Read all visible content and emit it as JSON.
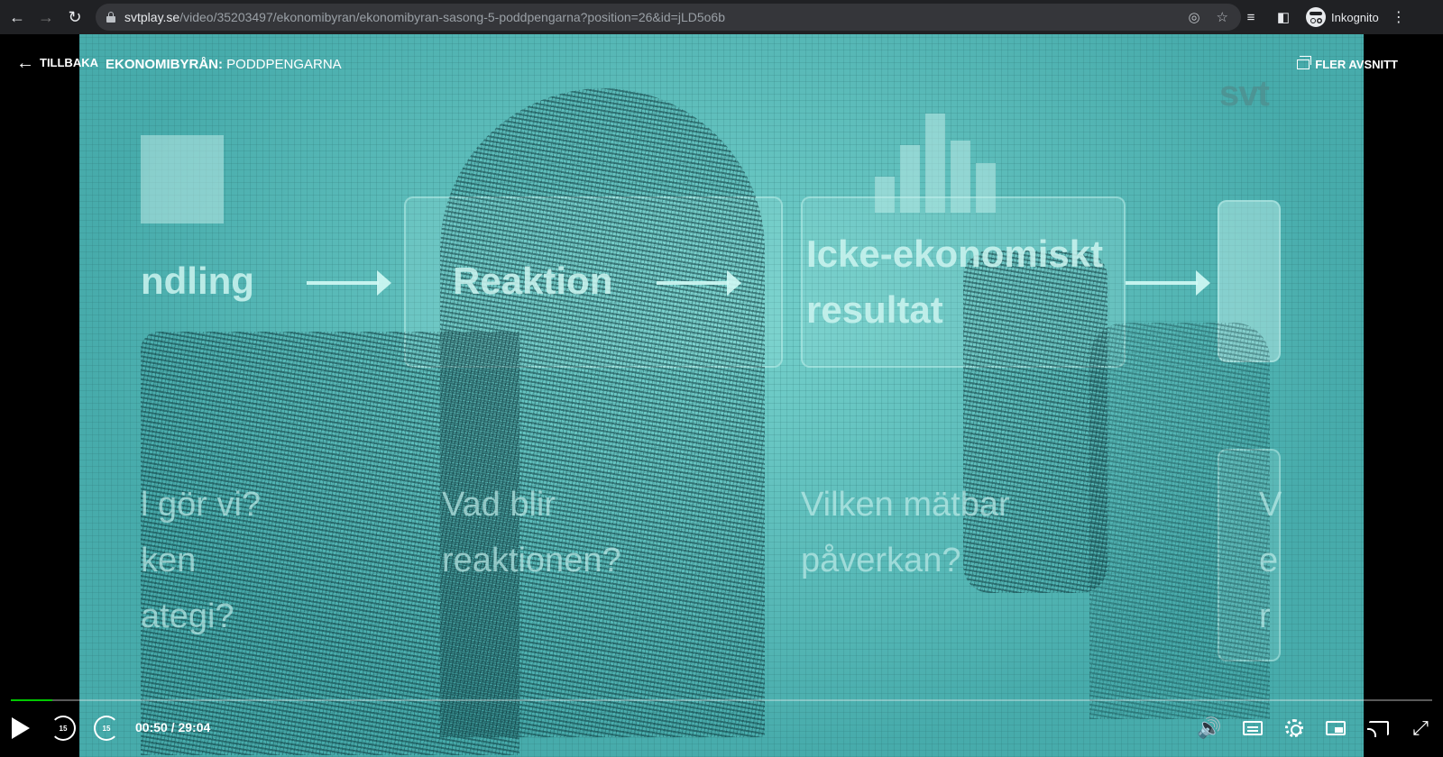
{
  "browser": {
    "url_host": "svtplay.se",
    "url_path": "/video/35203497/ekonomibyran/ekonomibyran-sasong-5-poddpengarna?position=26&id=jLD5o6b",
    "profile_label": "Inkognito"
  },
  "player": {
    "back_label": "TILLBAKA",
    "title_bold": "EKONOMIBYRÅN:",
    "title_rest": " PODDPENGARNA",
    "more_label": "FLER AVSNITT",
    "current_time": "00:50",
    "duration": "29:04",
    "time_display": "00:50 / 29:04",
    "progress_fraction": 0.029,
    "skip_back_label": "15",
    "skip_forward_label": "15",
    "accent_color": "#00c800"
  },
  "video_frame": {
    "logo_text": "svt",
    "labels": {
      "handling": "ndling",
      "reaktion": "Reaktion",
      "icke1": "Icke-ekonomiskt",
      "icke2": "resultat",
      "q1a": "l gör vi?",
      "q1b": "ken",
      "q1c": "ategi?",
      "q2a": "Vad blir",
      "q2b": "reaktionen?",
      "q3a": "Vilken mätbar",
      "q3b": "påverkan?",
      "q4a": "V",
      "q4b": "e",
      "q4c": "r"
    }
  },
  "icons": {
    "back": "arrow-left-icon",
    "forward": "arrow-right-icon",
    "reload": "reload-icon",
    "lock": "lock-icon",
    "eye_off": "eye-off-icon",
    "star": "star-icon",
    "reading_list": "reading-list-icon",
    "side_panel": "side-panel-icon",
    "incognito": "incognito-icon",
    "menu": "kebab-menu-icon"
  }
}
